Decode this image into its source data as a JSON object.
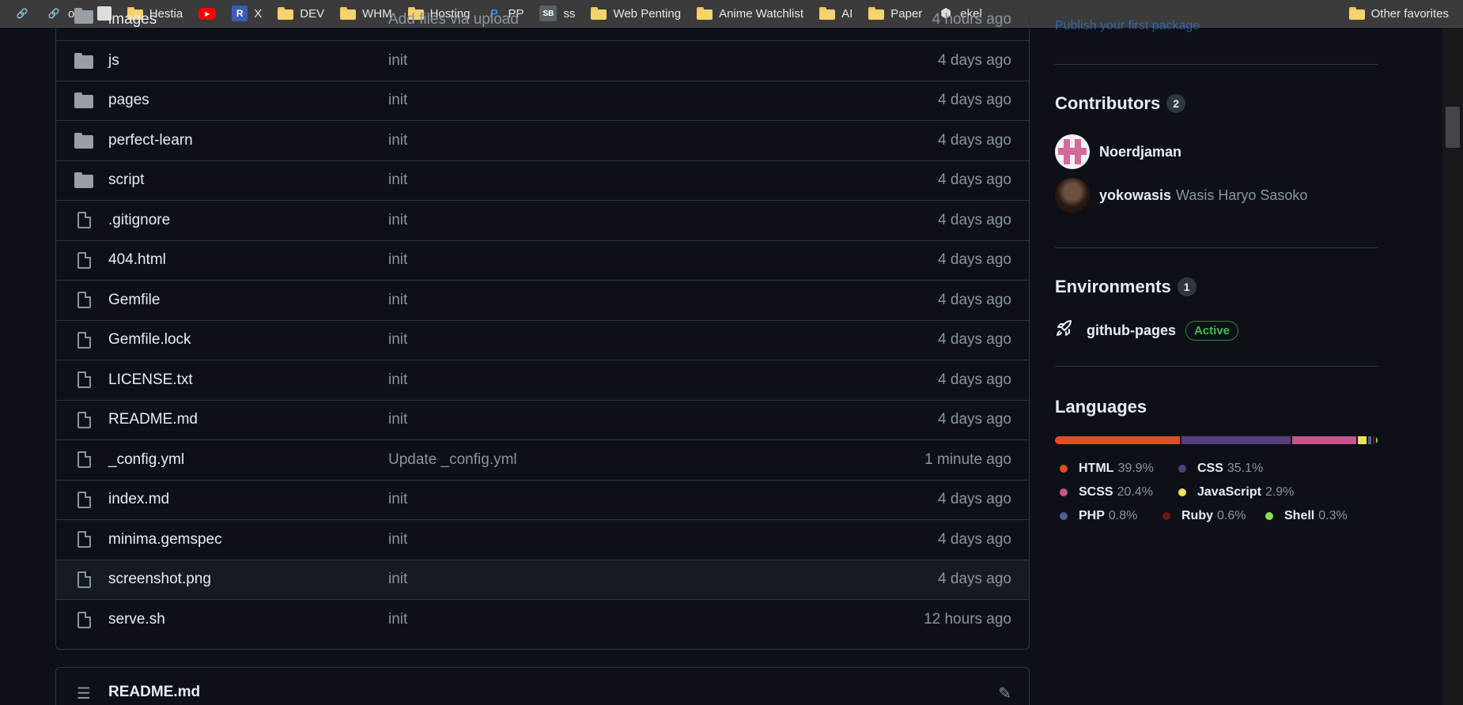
{
  "bookmarks": {
    "items": [
      {
        "label": "",
        "icon": "link-icon"
      },
      {
        "label": "oo",
        "icon": "link-icon"
      },
      {
        "label": "",
        "icon": "page-thumbnail-icon"
      },
      {
        "label": "Hestia",
        "icon": "folder-icon"
      },
      {
        "label": "",
        "icon": "youtube-icon"
      },
      {
        "label": "X",
        "icon": "r-badge-icon"
      },
      {
        "label": "DEV",
        "icon": "folder-icon"
      },
      {
        "label": "WHM",
        "icon": "folder-icon"
      },
      {
        "label": "Hosting",
        "icon": "folder-icon"
      },
      {
        "label": "PP",
        "icon": "paypal-icon"
      },
      {
        "label": "ss",
        "icon": "sb-badge-icon"
      },
      {
        "label": "Web Penting",
        "icon": "folder-icon"
      },
      {
        "label": "Anime Watchlist",
        "icon": "folder-icon"
      },
      {
        "label": "AI",
        "icon": "folder-icon"
      },
      {
        "label": "Paper",
        "icon": "folder-icon"
      },
      {
        "label": "ekel",
        "icon": "cube-icon"
      }
    ],
    "other": "Other favorites",
    "r_badge": "R",
    "sb_badge": "SB",
    "paypal_glyph": "P"
  },
  "files": [
    {
      "name": "images",
      "message": "Add files via upload",
      "time": "4 hours ago",
      "type": "dir"
    },
    {
      "name": "js",
      "message": "init",
      "time": "4 days ago",
      "type": "dir"
    },
    {
      "name": "pages",
      "message": "init",
      "time": "4 days ago",
      "type": "dir"
    },
    {
      "name": "perfect-learn",
      "message": "init",
      "time": "4 days ago",
      "type": "dir"
    },
    {
      "name": "script",
      "message": "init",
      "time": "4 days ago",
      "type": "dir"
    },
    {
      "name": ".gitignore",
      "message": "init",
      "time": "4 days ago",
      "type": "file"
    },
    {
      "name": "404.html",
      "message": "init",
      "time": "4 days ago",
      "type": "file"
    },
    {
      "name": "Gemfile",
      "message": "init",
      "time": "4 days ago",
      "type": "file"
    },
    {
      "name": "Gemfile.lock",
      "message": "init",
      "time": "4 days ago",
      "type": "file"
    },
    {
      "name": "LICENSE.txt",
      "message": "init",
      "time": "4 days ago",
      "type": "file"
    },
    {
      "name": "README.md",
      "message": "init",
      "time": "4 days ago",
      "type": "file"
    },
    {
      "name": "_config.yml",
      "message": "Update _config.yml",
      "time": "1 minute ago",
      "type": "file"
    },
    {
      "name": "index.md",
      "message": "init",
      "time": "4 days ago",
      "type": "file"
    },
    {
      "name": "minima.gemspec",
      "message": "init",
      "time": "4 days ago",
      "type": "file"
    },
    {
      "name": "screenshot.png",
      "message": "init",
      "time": "4 days ago",
      "type": "file"
    },
    {
      "name": "serve.sh",
      "message": "init",
      "time": "12 hours ago",
      "type": "file"
    }
  ],
  "readme": {
    "title": "README.md"
  },
  "sidebar": {
    "publish_link": "Publish your first package",
    "contributors": {
      "title": "Contributors",
      "count": "2",
      "people": [
        {
          "login": "Noerdjaman",
          "name": ""
        },
        {
          "login": "yokowasis",
          "name": "Wasis Haryo Sasoko"
        }
      ]
    },
    "environments": {
      "title": "Environments",
      "count": "1",
      "items": [
        {
          "name": "github-pages",
          "status": "Active"
        }
      ]
    },
    "languages": {
      "title": "Languages",
      "items": [
        {
          "name": "HTML",
          "pct": "39.9%",
          "color": "#e34c26"
        },
        {
          "name": "CSS",
          "pct": "35.1%",
          "color": "#563d7c"
        },
        {
          "name": "SCSS",
          "pct": "20.4%",
          "color": "#c6538c"
        },
        {
          "name": "JavaScript",
          "pct": "2.9%",
          "color": "#f1e05a"
        },
        {
          "name": "PHP",
          "pct": "0.8%",
          "color": "#4F5D95"
        },
        {
          "name": "Ruby",
          "pct": "0.6%",
          "color": "#701516"
        },
        {
          "name": "Shell",
          "pct": "0.3%",
          "color": "#89e051"
        }
      ]
    }
  }
}
